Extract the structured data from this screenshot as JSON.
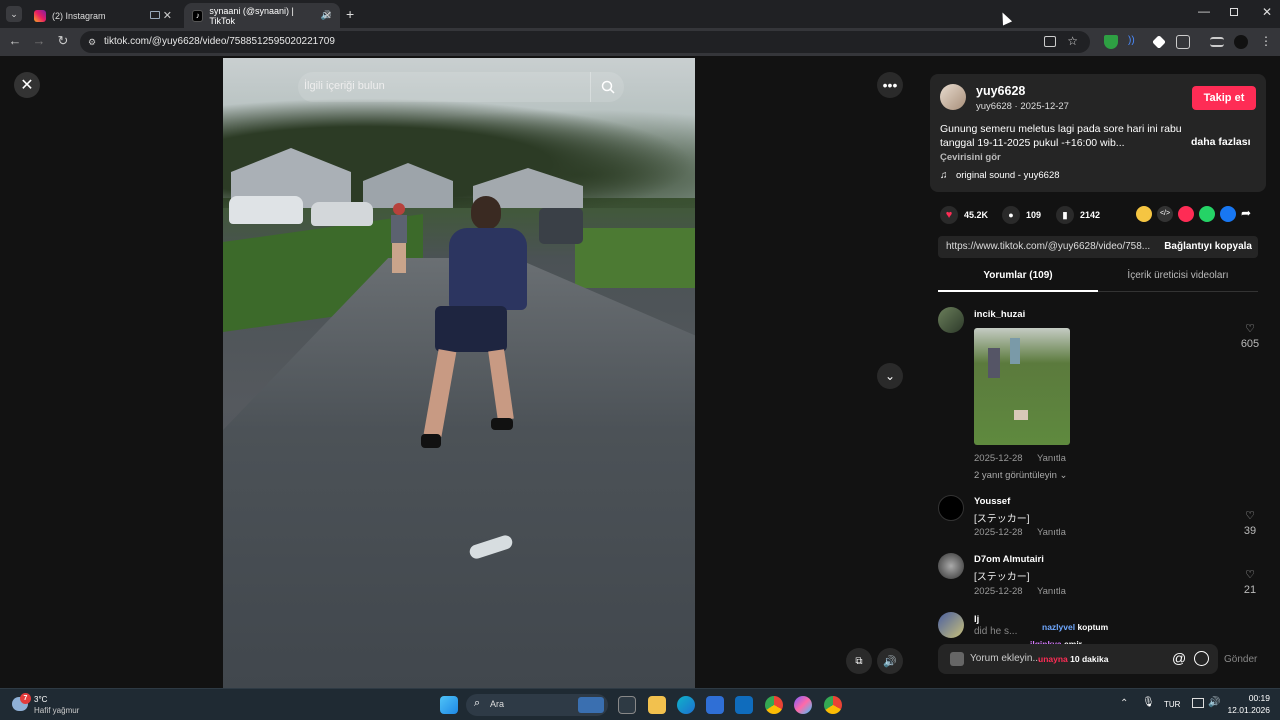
{
  "browser": {
    "tabs": [
      {
        "label": "(2) Instagram",
        "active": false
      },
      {
        "label": "synaani (@synaani) | TikTok",
        "active": true
      }
    ],
    "url": "tiktok.com/@yuy6628/video/7588512595020221709"
  },
  "video": {
    "search_placeholder": "İlgili içeriği bulun"
  },
  "author": {
    "username": "yuy6628",
    "meta": "yuy6628 · 2025-12-27",
    "follow_label": "Takip et",
    "caption": "Gunung semeru meletus lagi pada sore hari ini rabu tanggal 19-11-2025 pukul -+16:00 wib...",
    "more_label": "daha fazlası",
    "translate_label": "Çevirisini gör",
    "sound": "original sound - yuy6628"
  },
  "stats": {
    "likes": "45.2K",
    "comments": "109",
    "saves": "2142"
  },
  "share": {
    "link": "https://www.tiktok.com/@yuy6628/video/758...",
    "copy_label": "Bağlantıyı kopyala"
  },
  "panel_tabs": [
    {
      "label": "Yorumlar (109)",
      "active": true
    },
    {
      "label": "İçerik üreticisi videoları",
      "active": false
    }
  ],
  "comments": [
    {
      "user": "incik_huzai",
      "date": "2025-12-28",
      "reply": "Yanıtla",
      "likes": "605",
      "more_replies": "2 yanıt görüntüleyin"
    },
    {
      "user": "Youssef",
      "text": "[ステッカー]",
      "date": "2025-12-28",
      "reply": "Yanıtla",
      "likes": "39"
    },
    {
      "user": "D7om Almutairi",
      "text": "[ステッカー]",
      "date": "2025-12-28",
      "reply": "Yanıtla",
      "likes": "21"
    },
    {
      "user": "lj",
      "text": "did he s..."
    }
  ],
  "overlay_chat": [
    {
      "user": "nazlyvel",
      "text": "koptum"
    },
    {
      "user": "ilginkya",
      "text": "emir"
    },
    {
      "user": "unayna",
      "text": "10 dakika"
    }
  ],
  "comment_input": {
    "placeholder": "Yorum ekleyin...",
    "send_label": "Gönder"
  },
  "taskbar": {
    "weather_temp": "3°C",
    "weather_desc": "Hafif yağmur",
    "weather_badge": "7",
    "search_label": "Ara",
    "lang": "TUR",
    "time": "00:19",
    "date": "12.01.2026"
  }
}
